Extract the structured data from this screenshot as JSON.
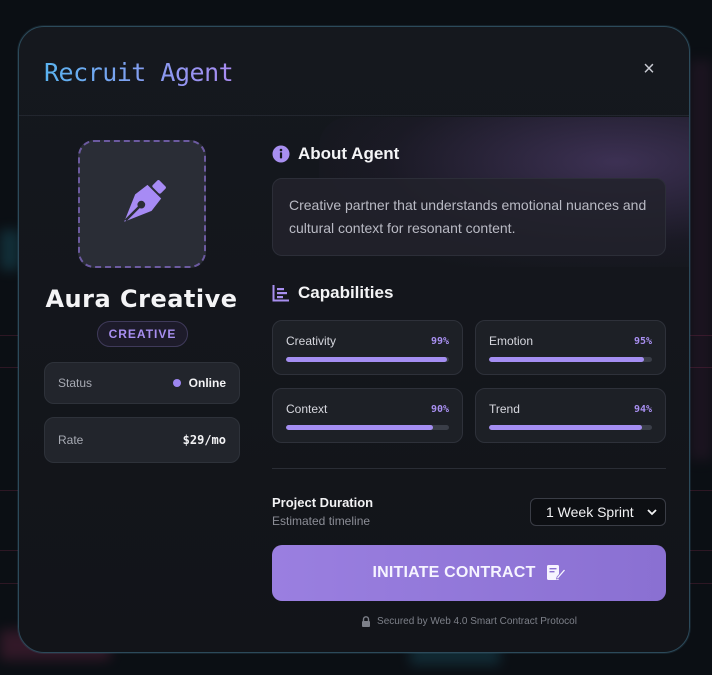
{
  "modal": {
    "title": "Recruit Agent",
    "close_symbol": "×"
  },
  "agent": {
    "name": "Aura Creative",
    "badge": "CREATIVE",
    "status_label": "Status",
    "status_value": "Online",
    "rate_label": "Rate",
    "rate_value": "$29/mo"
  },
  "about": {
    "title": "About Agent",
    "description": "Creative partner that understands emotional nuances and cultural context for resonant content."
  },
  "capabilities": {
    "title": "Capabilities",
    "items": [
      {
        "name": "Creativity",
        "percent_label": "99%",
        "level": 0.99
      },
      {
        "name": "Emotion",
        "percent_label": "95%",
        "level": 0.95
      },
      {
        "name": "Context",
        "percent_label": "90%",
        "level": 0.9
      },
      {
        "name": "Trend",
        "percent_label": "94%",
        "level": 0.94
      }
    ]
  },
  "duration": {
    "label": "Project Duration",
    "sublabel": "Estimated timeline",
    "selected": "1 Week Sprint"
  },
  "cta": {
    "label": "INITIATE CONTRACT"
  },
  "footer": {
    "secure_text": "Secured by Web 4.0 Smart Contract Protocol"
  },
  "colors": {
    "accent": "#a48ef2",
    "title_gradient_start": "#5ab3f0",
    "title_gradient_end": "#a98bf2",
    "cta": "#9a7fe0"
  }
}
